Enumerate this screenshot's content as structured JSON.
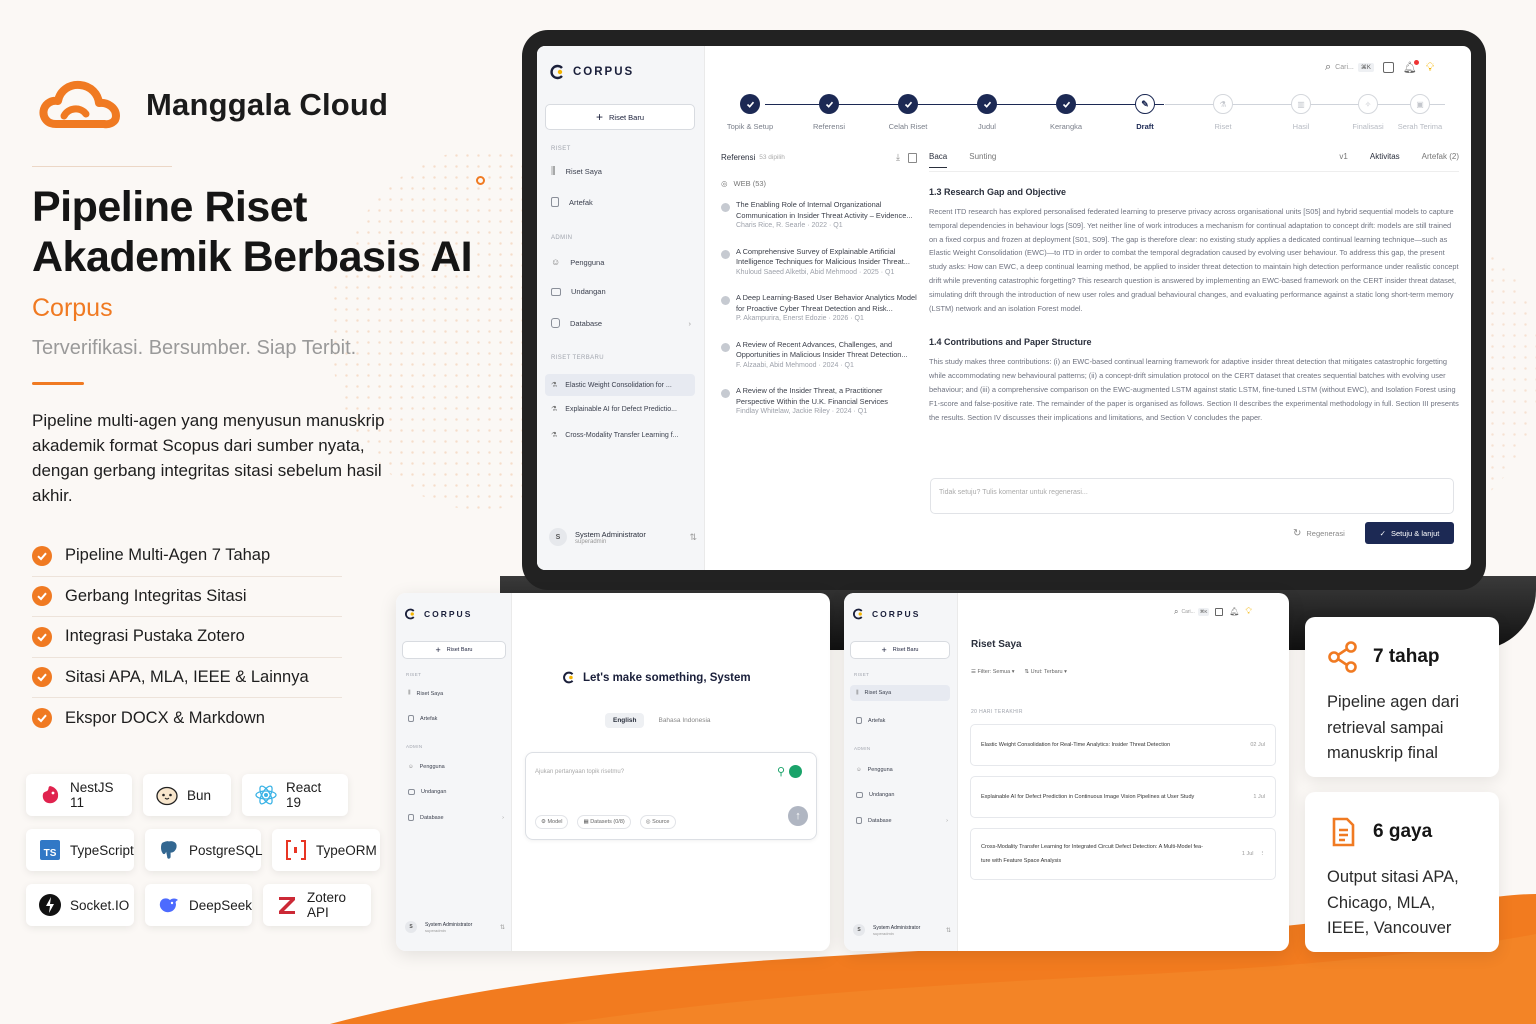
{
  "brand": {
    "name": "Manggala Cloud"
  },
  "hero": {
    "title_line1": "Pipeline Riset",
    "title_line2": "Akademik Berbasis AI",
    "product": "Corpus",
    "tagline": "Terverifikasi. Bersumber. Siap Terbit.",
    "description": "Pipeline multi-agen yang menyusun manuskrip akademik format Scopus dari sumber nyata, dengan gerbang integritas sitasi sebelum hasil akhir."
  },
  "features": [
    "Pipeline Multi-Agen 7 Tahap",
    "Gerbang Integritas Sitasi",
    "Integrasi Pustaka Zotero",
    "Sitasi APA, MLA, IEEE & Lainnya",
    "Ekspor DOCX & Markdown"
  ],
  "tech": [
    {
      "label": "NestJS 11",
      "icon": "nestjs-icon",
      "color": "#e0234e"
    },
    {
      "label": "Bun",
      "icon": "bun-icon",
      "color": "#f5e1c8"
    },
    {
      "label": "React 19",
      "icon": "react-icon",
      "color": "#3bb3e6"
    },
    {
      "label": "TypeScript",
      "icon": "typescript-icon",
      "color": "#3178c6"
    },
    {
      "label": "PostgreSQL",
      "icon": "postgresql-icon",
      "color": "#336791"
    },
    {
      "label": "TypeORM",
      "icon": "typeorm-icon",
      "color": "#e83524"
    },
    {
      "label": "Socket.IO",
      "icon": "socketio-icon",
      "color": "#111111"
    },
    {
      "label": "DeepSeek",
      "icon": "deepseek-icon",
      "color": "#4d6bfe"
    },
    {
      "label": "Zotero API",
      "icon": "zotero-icon",
      "color": "#cc2936"
    }
  ],
  "app": {
    "logo": "CORPUS",
    "new_button": "Riset Baru",
    "section_riset": "RISET",
    "nav_riset": [
      "Riset Saya",
      "Artefak"
    ],
    "section_admin": "ADMIN",
    "nav_admin": [
      "Pengguna",
      "Undangan",
      "Database"
    ],
    "section_recent": "RISET TERBARU",
    "recent": [
      "Elastic Weight Consolidation for ...",
      "Explainable AI for Defect Predictio...",
      "Cross-Modality Transfer Learning f..."
    ],
    "user_name": "System Administrator",
    "user_role": "superadmin",
    "user_initial": "S",
    "search_placeholder": "Cari...",
    "search_kbd": "⌘K",
    "steps": [
      "Topik & Setup",
      "Referensi",
      "Celah Riset",
      "Judul",
      "Kerangka",
      "Draft",
      "Riset",
      "Hasil",
      "Finalisasi",
      "Serah Terima"
    ],
    "refs_title": "Referensi",
    "refs_count": "53 dipilih",
    "refs_group": "WEB (53)",
    "references": [
      {
        "title": "The Enabling Role of Internal Organizational Communication in Insider Threat Activity – Evidence...",
        "meta": "Charis Rice, R. Searle · 2022 · Q1"
      },
      {
        "title": "A Comprehensive Survey of Explainable Artificial Intelligence Techniques for Malicious Insider Threat...",
        "meta": "Khuloud Saeed Alketbi, Abid Mehmood · 2025 · Q1"
      },
      {
        "title": "A Deep Learning-Based User Behavior Analytics Model for Proactive Cyber Threat Detection and Risk...",
        "meta": "P. Akampurira, Enerst Edozie · 2026 · Q1"
      },
      {
        "title": "A Review of Recent Advances, Challenges, and Opportunities in Malicious Insider Threat Detection...",
        "meta": "F. Alzaabi, Abid Mehmood · 2024 · Q1"
      },
      {
        "title": "A Review of the Insider Threat, a Practitioner Perspective Within the U.K. Financial Services",
        "meta": "Findlay Whitelaw, Jackie Riley · 2024 · Q1"
      }
    ],
    "doc_tabs": [
      "Baca",
      "Sunting"
    ],
    "doc_version": "v1",
    "doc_tab_activity": "Aktivitas",
    "doc_tab_artifacts": "Artefak (2)",
    "section_13_title": "1.3 Research Gap and Objective",
    "section_13_body": "Recent ITD research has explored personalised federated learning to preserve privacy across organisational units [S05] and hybrid sequential models to capture temporal dependencies in behaviour logs [S09]. Yet neither line of work introduces a mechanism for continual adaptation to concept drift: models are still trained on a fixed corpus and frozen at deployment [S01, S09]. The gap is therefore clear: no existing study applies a dedicated continual learning technique—such as Elastic Weight Consolidation (EWC)—to ITD in order to combat the temporal degradation caused by evolving user behaviour. To address this gap, the present study asks: How can EWC, a deep continual learning method, be applied to insider threat detection to maintain high detection performance under realistic concept drift while preventing catastrophic forgetting? This research question is answered by implementing an EWC-based framework on the CERT insider threat dataset, simulating drift through the introduction of new user roles and gradual behavioural changes, and evaluating performance against a static long short-term memory (LSTM) network and an isolation Forest model.",
    "section_14_title": "1.4 Contributions and Paper Structure",
    "section_14_body": "This study makes three contributions: (i) an EWC-based continual learning framework for adaptive insider threat detection that mitigates catastrophic forgetting while accommodating new behavioural patterns; (ii) a concept-drift simulation protocol on the CERT dataset that creates sequential batches with evolving user behaviour; and (iii) a comprehensive comparison on the EWC-augmented LSTM against static LSTM, fine-tuned LSTM (without EWC), and Isolation Forest using F1-score and false-positive rate. The remainder of the paper is organised as follows. Section II describes the experimental methodology in full. Section III presents the results. Section IV discusses their implications and limitations, and Section V concludes the paper.",
    "comment_placeholder": "Tidak setuju? Tulis komentar untuk regenerasi...",
    "regen_button": "Regenerasi",
    "approve_button": "Setuju & lanjut"
  },
  "chat_screen": {
    "greeting": "Let's make something, System",
    "lang_active": "English",
    "lang_other": "Bahasa Indonesia",
    "input_placeholder": "Ajukan pertanyaan topik risetmu?",
    "chip_model": "Model",
    "chip_datasets": "Datasets (0/8)",
    "chip_source": "Source"
  },
  "list_screen": {
    "title": "Riset Saya",
    "filter_label": "Filter: Semua",
    "sort_label": "Urut: Terbaru",
    "group": "20 HARI TERAKHIR",
    "items": [
      {
        "title": "Elastic Weight Consolidation for Real-Time Analytics: Insider Threat Detection",
        "date": "02 Jul"
      },
      {
        "title": "Explainable AI for Defect Prediction in Continuous Image Vision Pipelines at User Study",
        "date": "1 Jul"
      },
      {
        "title": "Cross-Modality Transfer Learning for Integrated Circuit Defect Detection: A Multi-Model fea-",
        "title2": "ture with Feature Space Analysis",
        "date": "1 Jul"
      }
    ]
  },
  "info_cards": [
    {
      "heading": "7 tahap",
      "icon": "share-nodes-icon",
      "body": "Pipeline agen dari retrieval sampai manuskrip final"
    },
    {
      "heading": "6 gaya",
      "icon": "document-icon",
      "body": "Output sitasi APA, Chicago, MLA, IEEE, Vancouver"
    }
  ],
  "colors": {
    "accent": "#f07a22",
    "navy": "#1c2954",
    "bg": "#fbf8f5"
  }
}
